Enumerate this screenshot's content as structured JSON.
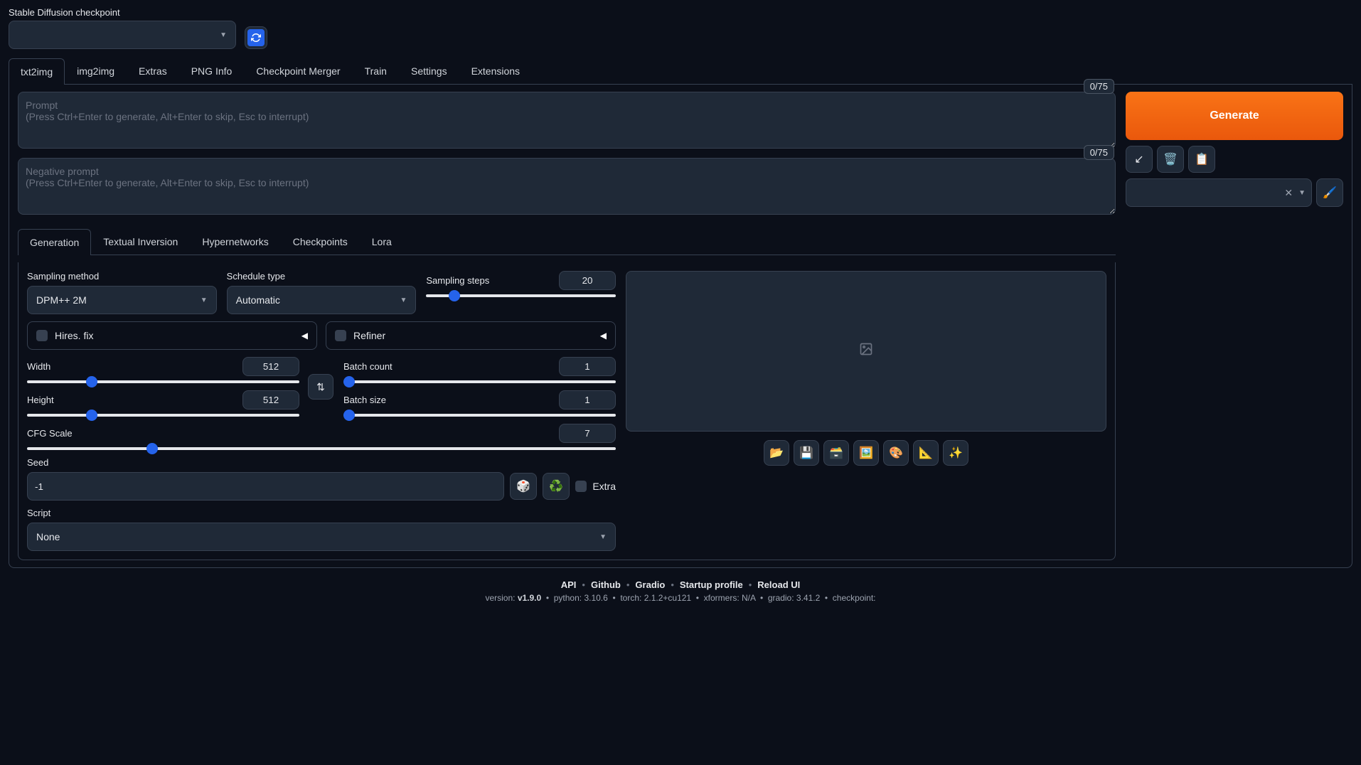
{
  "checkpoint": {
    "label": "Stable Diffusion checkpoint",
    "value": ""
  },
  "main_tabs": [
    "txt2img",
    "img2img",
    "Extras",
    "PNG Info",
    "Checkpoint Merger",
    "Train",
    "Settings",
    "Extensions"
  ],
  "prompt": {
    "counter": "0/75",
    "placeholder": "Prompt\n(Press Ctrl+Enter to generate, Alt+Enter to skip, Esc to interrupt)"
  },
  "neg_prompt": {
    "counter": "0/75",
    "placeholder": "Negative prompt\n(Press Ctrl+Enter to generate, Alt+Enter to skip, Esc to interrupt)"
  },
  "generate_label": "Generate",
  "sub_tabs": [
    "Generation",
    "Textual Inversion",
    "Hypernetworks",
    "Checkpoints",
    "Lora"
  ],
  "sampling_method": {
    "label": "Sampling method",
    "value": "DPM++ 2M"
  },
  "schedule_type": {
    "label": "Schedule type",
    "value": "Automatic"
  },
  "sampling_steps": {
    "label": "Sampling steps",
    "value": 20,
    "min": 1,
    "max": 150
  },
  "hires_fix": {
    "label": "Hires. fix"
  },
  "refiner": {
    "label": "Refiner"
  },
  "width": {
    "label": "Width",
    "value": 512,
    "min": 64,
    "max": 2048
  },
  "height": {
    "label": "Height",
    "value": 512,
    "min": 64,
    "max": 2048
  },
  "batch_count": {
    "label": "Batch count",
    "value": 1,
    "min": 1,
    "max": 100
  },
  "batch_size": {
    "label": "Batch size",
    "value": 1,
    "min": 1,
    "max": 8
  },
  "cfg_scale": {
    "label": "CFG Scale",
    "value": 7,
    "min": 1,
    "max": 30
  },
  "seed": {
    "label": "Seed",
    "value": "-1"
  },
  "extra_label": "Extra",
  "script": {
    "label": "Script",
    "value": "None"
  },
  "footer_links": [
    "API",
    "Github",
    "Gradio",
    "Startup profile",
    "Reload UI"
  ],
  "footer_version": {
    "version": "v1.9.0",
    "python": "3.10.6",
    "torch": "2.1.2+cu121",
    "xformers": "N/A",
    "gradio": "3.41.2",
    "checkpoint_suffix": ""
  }
}
